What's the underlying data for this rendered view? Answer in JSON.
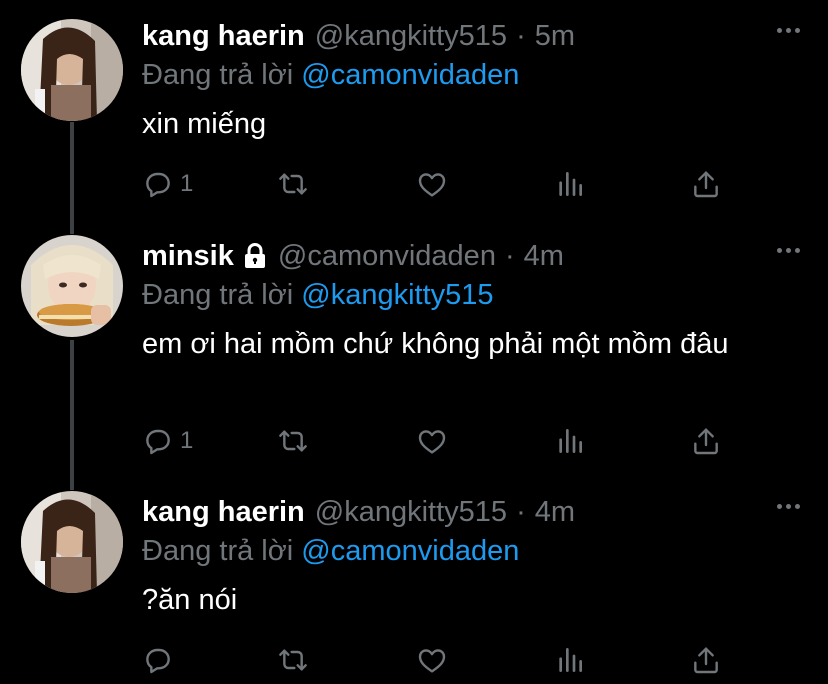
{
  "colors": {
    "background": "#000000",
    "text": "#ffffff",
    "muted": "#71767b",
    "link": "#1d9bf0",
    "thread_line": "#3e4144"
  },
  "labels": {
    "replying_to": "Đang trả lời"
  },
  "tweets": [
    {
      "display_name": "kang haerin",
      "protected": false,
      "handle": "@kangkitty515",
      "separator": "·",
      "time": "5m",
      "replying_to": "@camonvidaden",
      "text": "xin miếng",
      "reply_count": "1",
      "avatar_icon": "avatar-photo",
      "icons": [
        "reply-icon",
        "retweet-icon",
        "like-icon",
        "analytics-icon",
        "share-icon"
      ]
    },
    {
      "display_name": "minsik",
      "protected": true,
      "handle": "@camonvidaden",
      "separator": "·",
      "time": "4m",
      "replying_to": "@kangkitty515",
      "text": "em ơi hai mồm chứ không phải một mồm đâu",
      "reply_count": "1",
      "avatar_icon": "avatar-photo",
      "icons": [
        "reply-icon",
        "retweet-icon",
        "like-icon",
        "analytics-icon",
        "share-icon"
      ]
    },
    {
      "display_name": "kang haerin",
      "protected": false,
      "handle": "@kangkitty515",
      "separator": "·",
      "time": "4m",
      "replying_to": "@camonvidaden",
      "text": "?ăn nói",
      "reply_count": "",
      "avatar_icon": "avatar-photo",
      "icons": [
        "reply-icon",
        "retweet-icon",
        "like-icon",
        "analytics-icon",
        "share-icon"
      ]
    }
  ]
}
